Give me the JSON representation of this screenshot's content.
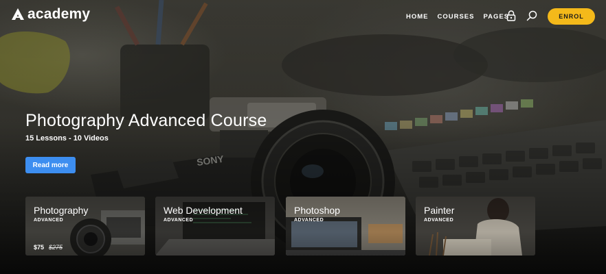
{
  "brand": {
    "name": "academy"
  },
  "nav": {
    "items": [
      {
        "label": "HOME"
      },
      {
        "label": "COURSES"
      },
      {
        "label": "PAGES"
      }
    ],
    "icons": {
      "lock": "lock-icon",
      "search": "search-icon"
    },
    "cta_label": "ENROL"
  },
  "hero": {
    "title": "Photography Advanced Course",
    "subtitle": "15 Lessons - 10 Videos",
    "button_label": "Read more"
  },
  "cards": [
    {
      "title": "Photography",
      "level": "ADVANCED",
      "price": "$75",
      "old_price": "$275"
    },
    {
      "title": "Web Development",
      "level": "ADVANCED"
    },
    {
      "title": "Photoshop",
      "level": "ADVANCED"
    },
    {
      "title": "Painter",
      "level": "ADVANCED"
    }
  ],
  "colors": {
    "accent": "#f4b91a",
    "button_blue": "#3d8ef0"
  }
}
